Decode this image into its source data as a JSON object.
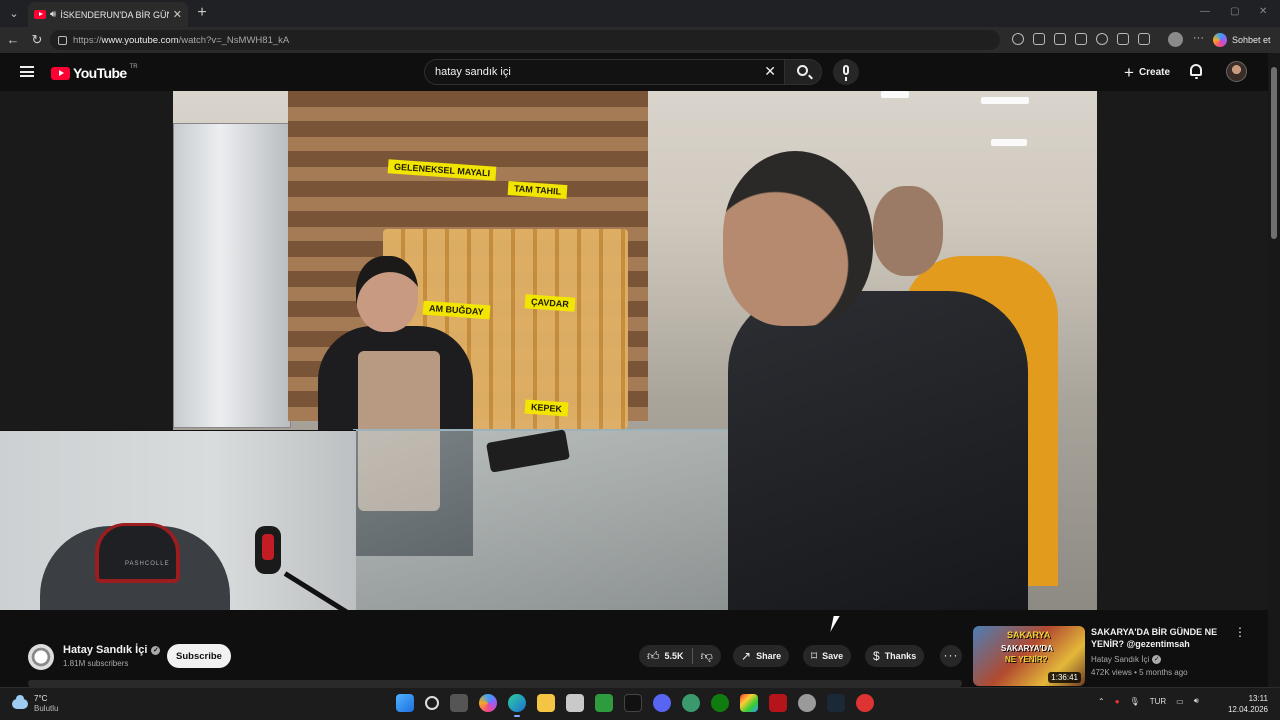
{
  "browser": {
    "tab_title": "İSKENDERUN'DA BİR GÜNDE",
    "url_prefix": "https://",
    "url_host": "www.youtube.com",
    "url_path": "/watch?v=_NsMWH81_kA",
    "copilot_label": "Sohbet et"
  },
  "youtube": {
    "logo_text": "YouTube",
    "region": "TR",
    "search_query": "hatay sandık içi",
    "create_label": "Create"
  },
  "video_overlay": {
    "sign_1": "GELENEKSEL MAYALI",
    "sign_2": "TAM TAHIL",
    "sign_3": "AM BUĞDAY",
    "sign_4": "ÇAVDAR",
    "sign_5": "KEPEK",
    "chair_brand": "PASHCOLLE"
  },
  "channel": {
    "name": "Hatay Sandık İçi",
    "subscribers": "1.81M subscribers",
    "subscribe_label": "Subscribe"
  },
  "actions": {
    "likes": "5.5K",
    "share": "Share",
    "save": "Save",
    "thanks": "Thanks"
  },
  "recommendation": {
    "title": "SAKARYA'DA BİR GÜNDE NE YENİR? @gezentimsah",
    "channel": "Hatay Sandık İçi",
    "meta": "472K views • 5 months ago",
    "duration": "1:36:41",
    "thumb_text_1": "SAKARYA",
    "thumb_text_2": "SAKARYA'DA",
    "thumb_text_3": "NE YENİR?"
  },
  "taskbar": {
    "temp": "7°C",
    "weather": "Bulutlu",
    "lang": "TUR",
    "time": "13:11",
    "date": "12.04.2026"
  },
  "colors": {
    "brand_red": "#ff0033",
    "bg": "#0f0f0f",
    "chip": "#272727"
  }
}
